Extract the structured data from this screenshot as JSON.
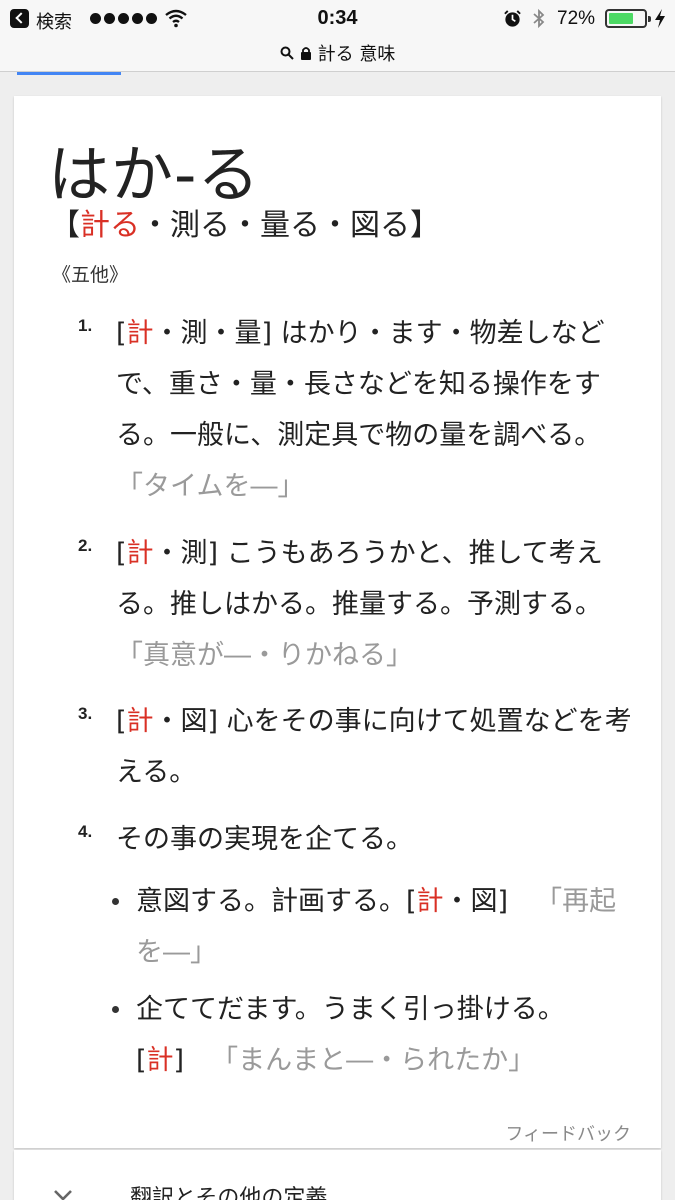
{
  "status_bar": {
    "back_label": "検索",
    "time": "0:34",
    "battery_percent": "72%",
    "battery_level": 0.72
  },
  "url_bar": {
    "url": "計る 意味"
  },
  "entry": {
    "headword": "はか-る",
    "kanji_open": "【",
    "kanji_primary": "計る",
    "kanji_rest": "・測る・量る・図る",
    "kanji_close": "】",
    "part_of_speech": "《五他》"
  },
  "senses": [
    {
      "number": "1.",
      "tag_open": "[",
      "tag_red": "計",
      "tag_rest": "・測・量]",
      "text": " はかり・ます・物差しなどで、重さ・量・長さなどを知る操作をする。一般に、測定具で物の量を調べる。",
      "example": "「タイムを―」"
    },
    {
      "number": "2.",
      "tag_open": "[",
      "tag_red": "計",
      "tag_rest": "・測]",
      "text": " こうもあろうかと、推して考える。推しはかる。推量する。予測する。",
      "example": "「真意が―・りかねる」"
    },
    {
      "number": "3.",
      "tag_open": "[",
      "tag_red": "計",
      "tag_rest": "・図]",
      "text": " 心をその事に向けて処置などを考える。",
      "example": ""
    },
    {
      "number": "4.",
      "text": "その事の実現を企てる。"
    }
  ],
  "subsenses": [
    {
      "text": "意図する。計画する。",
      "tag_open": "[",
      "tag_red": "計",
      "tag_rest": "・図]",
      "example": "「再起を―」"
    },
    {
      "text": "企ててだます。うまく引っ掛ける。",
      "tag_open": "[",
      "tag_red": "計",
      "tag_rest": "]",
      "example": "「まんまと―・られたか」"
    }
  ],
  "feedback_label": "フィードバック",
  "more_section": {
    "label": "翻訳とその他の定義"
  },
  "colors": {
    "accent_red": "#d93025",
    "example_gray": "#9a9a9a",
    "battery_green": "#4cd964",
    "progress_blue": "#4285f4"
  },
  "icons": [
    "back-chevron-icon",
    "signal-dots-icon",
    "wifi-icon",
    "alarm-icon",
    "bluetooth-icon",
    "battery-icon",
    "charging-bolt-icon",
    "search-icon",
    "lock-icon",
    "expand-chevron-icon"
  ]
}
